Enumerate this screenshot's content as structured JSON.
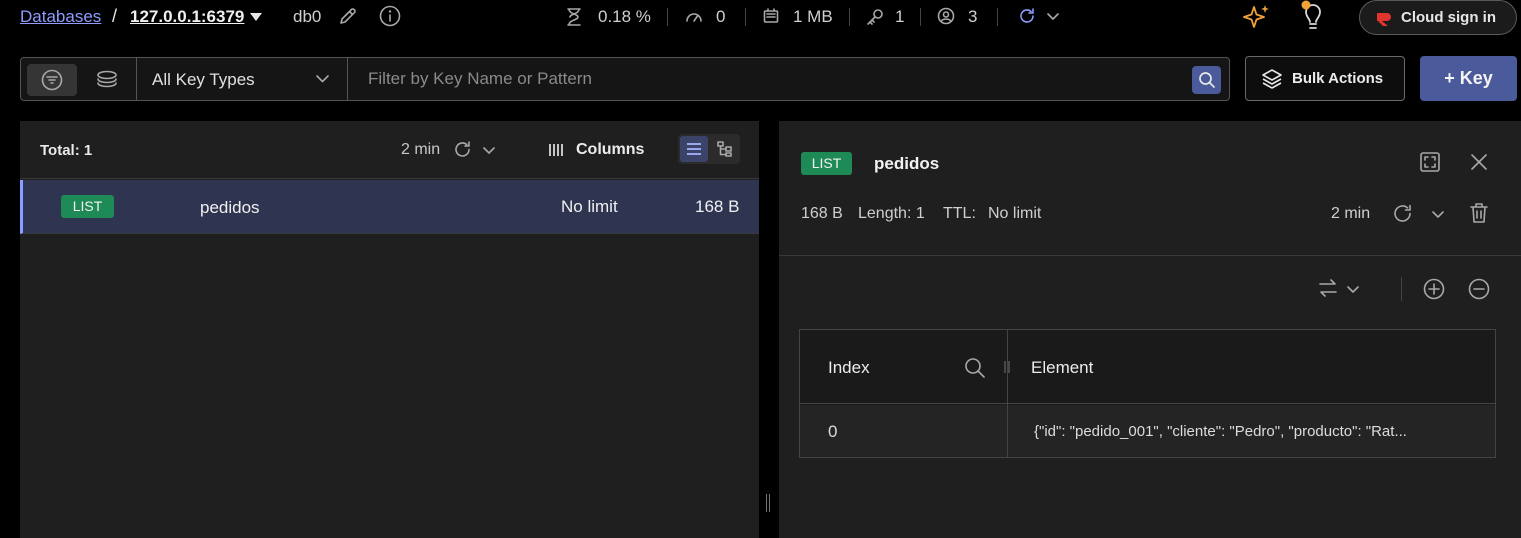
{
  "breadcrumb": {
    "databases_label": "Databases",
    "separator": "/",
    "host": "127.0.0.1:6379"
  },
  "db": {
    "name": "db0"
  },
  "stats": {
    "cpu": "0.18 %",
    "ops": "0",
    "memory": "1 MB",
    "keys": "1",
    "clients": "3"
  },
  "cloud_button": {
    "label": "Cloud sign in"
  },
  "filter": {
    "key_type": "All Key Types",
    "placeholder": "Filter by Key Name or Pattern",
    "value": ""
  },
  "actions": {
    "bulk_label": "Bulk Actions",
    "add_key_label": "+ Key"
  },
  "key_list": {
    "total_label": "Total: 1",
    "refresh_time": "2 min",
    "columns_label": "Columns",
    "rows": [
      {
        "type": "LIST",
        "name": "pedidos",
        "ttl": "No limit",
        "size": "168 B"
      }
    ]
  },
  "details": {
    "type": "LIST",
    "name": "pedidos",
    "size": "168 B",
    "length_label": "Length: 1",
    "ttl_label": "TTL:",
    "ttl_value": "No limit",
    "refresh_time": "2 min",
    "table": {
      "col_index": "Index",
      "col_element": "Element",
      "rows": [
        {
          "index": "0",
          "element": "{\"id\": \"pedido_001\", \"cliente\": \"Pedro\", \"producto\": \"Rat..."
        }
      ]
    }
  },
  "colors": {
    "accent": "#8e9cff",
    "primary_button": "#4b5a9a",
    "list_badge": "#1e8a56",
    "selected_row": "#2f3550"
  },
  "icons": [
    "pencil-icon",
    "info-icon",
    "cpu-icon",
    "speedometer-icon",
    "memory-icon",
    "key-icon",
    "users-icon",
    "refresh-icon",
    "sparkles-icon",
    "lightbulb-icon",
    "cloud-logo-icon",
    "filter-icon",
    "layers-icon",
    "search-icon",
    "stack-icon",
    "columns-icon",
    "list-view-icon",
    "tree-view-icon",
    "fullscreen-icon",
    "close-icon",
    "trash-icon",
    "swap-icon",
    "plus-circle-icon",
    "minus-circle-icon"
  ]
}
